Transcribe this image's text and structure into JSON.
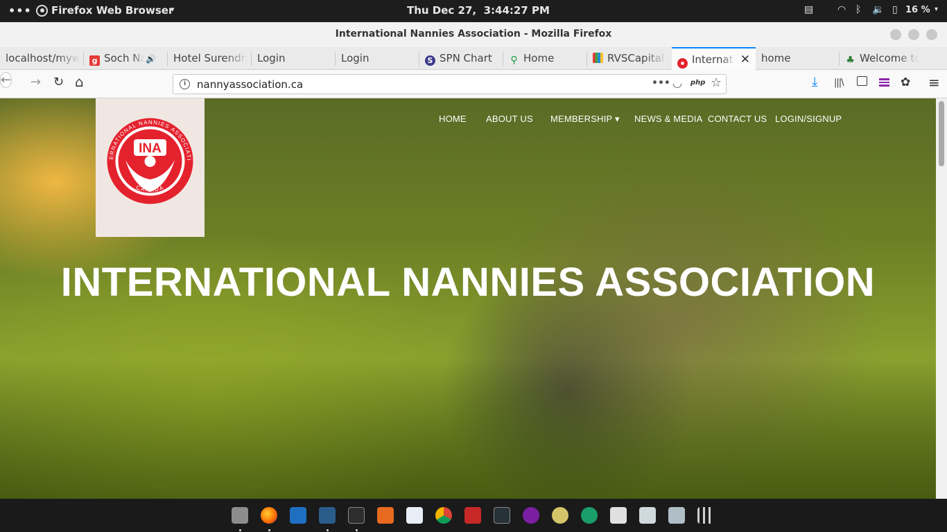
{
  "system_bar": {
    "activities": "•••",
    "app_name": "Firefox Web Browser",
    "caret": "▾",
    "clock": "Thu Dec 27,  3:44:27 PM",
    "battery": "16 %"
  },
  "window": {
    "title": "International Nannies Association - Mozilla Firefox"
  },
  "tabs": [
    {
      "label": "localhost/myw",
      "favicon": "none"
    },
    {
      "label": "Soch Na S",
      "favicon": "g-badge-icon",
      "audio": "🔊"
    },
    {
      "label": "Hotel Surendra",
      "favicon": "none"
    },
    {
      "label": "Login",
      "favicon": "none"
    },
    {
      "label": "Login",
      "favicon": "none"
    },
    {
      "label": "SPN Chart",
      "favicon": "s-badge-icon"
    },
    {
      "label": "Home",
      "favicon": "magnifier-icon"
    },
    {
      "label": "RVSCapital",
      "favicon": "bars-icon"
    },
    {
      "label": "Internati",
      "favicon": "ina-icon",
      "close": "✕"
    },
    {
      "label": "home",
      "favicon": "none"
    },
    {
      "label": "Welcome to",
      "favicon": "tree-icon"
    }
  ],
  "new_tab": "+",
  "navbar": {
    "back": "←",
    "forward": "→",
    "reload": "↻",
    "home": "⌂",
    "info": "i",
    "url": "nannyassociation.ca",
    "page_actions": "•••",
    "php_badge": "php",
    "bookmark": "☆",
    "download": "⤓",
    "library": "|||\\",
    "menu": "≡"
  },
  "site": {
    "logo_initials": "INA",
    "logo_ring_text": "INTERNATIONAL NANNIES ASSOCIATION",
    "logo_country": "CANADA",
    "nav": [
      {
        "label": "HOME"
      },
      {
        "label": "ABOUT US"
      },
      {
        "label": "MEMBERSHIP ▾"
      },
      {
        "label": "NEWS & MEDIA"
      },
      {
        "label": "CONTACT US"
      },
      {
        "label": "LOGIN/SIGNUP"
      }
    ],
    "hero_title": "INTERNATIONAL NANNIES ASSOCIATION"
  },
  "colors": {
    "accent": "#0a84ff",
    "logo_red": "#e4222e",
    "banner": "#f1e7e2"
  },
  "dock_icons": [
    "files-icon",
    "firefox-icon",
    "vscode-icon",
    "mysql-workbench-icon",
    "terminal-icon",
    "software-center-icon",
    "document-viewer-icon",
    "chrome-icon",
    "filezilla-icon",
    "system-monitor-icon",
    "app-icon",
    "webcam-icon",
    "app-icon",
    "app-icon",
    "app-icon",
    "settings-icon",
    "app-grid-icon"
  ]
}
